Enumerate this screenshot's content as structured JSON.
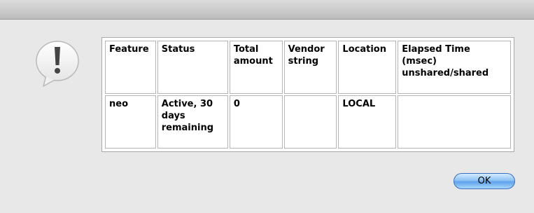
{
  "dialog": {
    "icon": "alert-exclamation-icon",
    "ok_label": "OK"
  },
  "table": {
    "columns": [
      "Feature",
      "Status",
      "Total amount",
      "Vendor string",
      "Location",
      "Elapsed Time (msec) unshared/shared"
    ],
    "rows": [
      [
        "neo",
        "Active, 30 days remaining",
        "0",
        "",
        "LOCAL",
        ""
      ]
    ]
  },
  "colors": {
    "background": "#e8e8e8",
    "button_accent": "#5ea3ea"
  }
}
